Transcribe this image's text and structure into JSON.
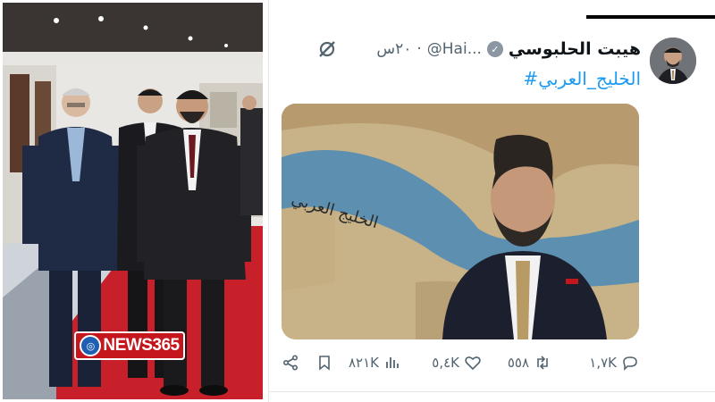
{
  "photo_panel": {
    "watermark": {
      "text": "NEWS365",
      "globe_icon": "globe-icon"
    }
  },
  "tweet": {
    "author": {
      "name": "هيبت الحلبوسي",
      "handle": "@Hai...",
      "separator": "·",
      "time": "٢٠س",
      "verified_badge": "verified-badge-icon"
    },
    "hashtag": "#الخليج_العربي",
    "media": {
      "map_caption": "الخليج العربي"
    },
    "actions": {
      "replies": "١,٧K",
      "retweets": "٥٥٨",
      "likes": "٥,٤K",
      "views": "٨٢١K",
      "bookmark_icon": "bookmark-icon",
      "share_icon": "share-icon"
    }
  },
  "colors": {
    "link": "#1d9bf0",
    "muted": "#536471",
    "watermark_red": "#c4161c",
    "carpet_red": "#c8202a"
  }
}
